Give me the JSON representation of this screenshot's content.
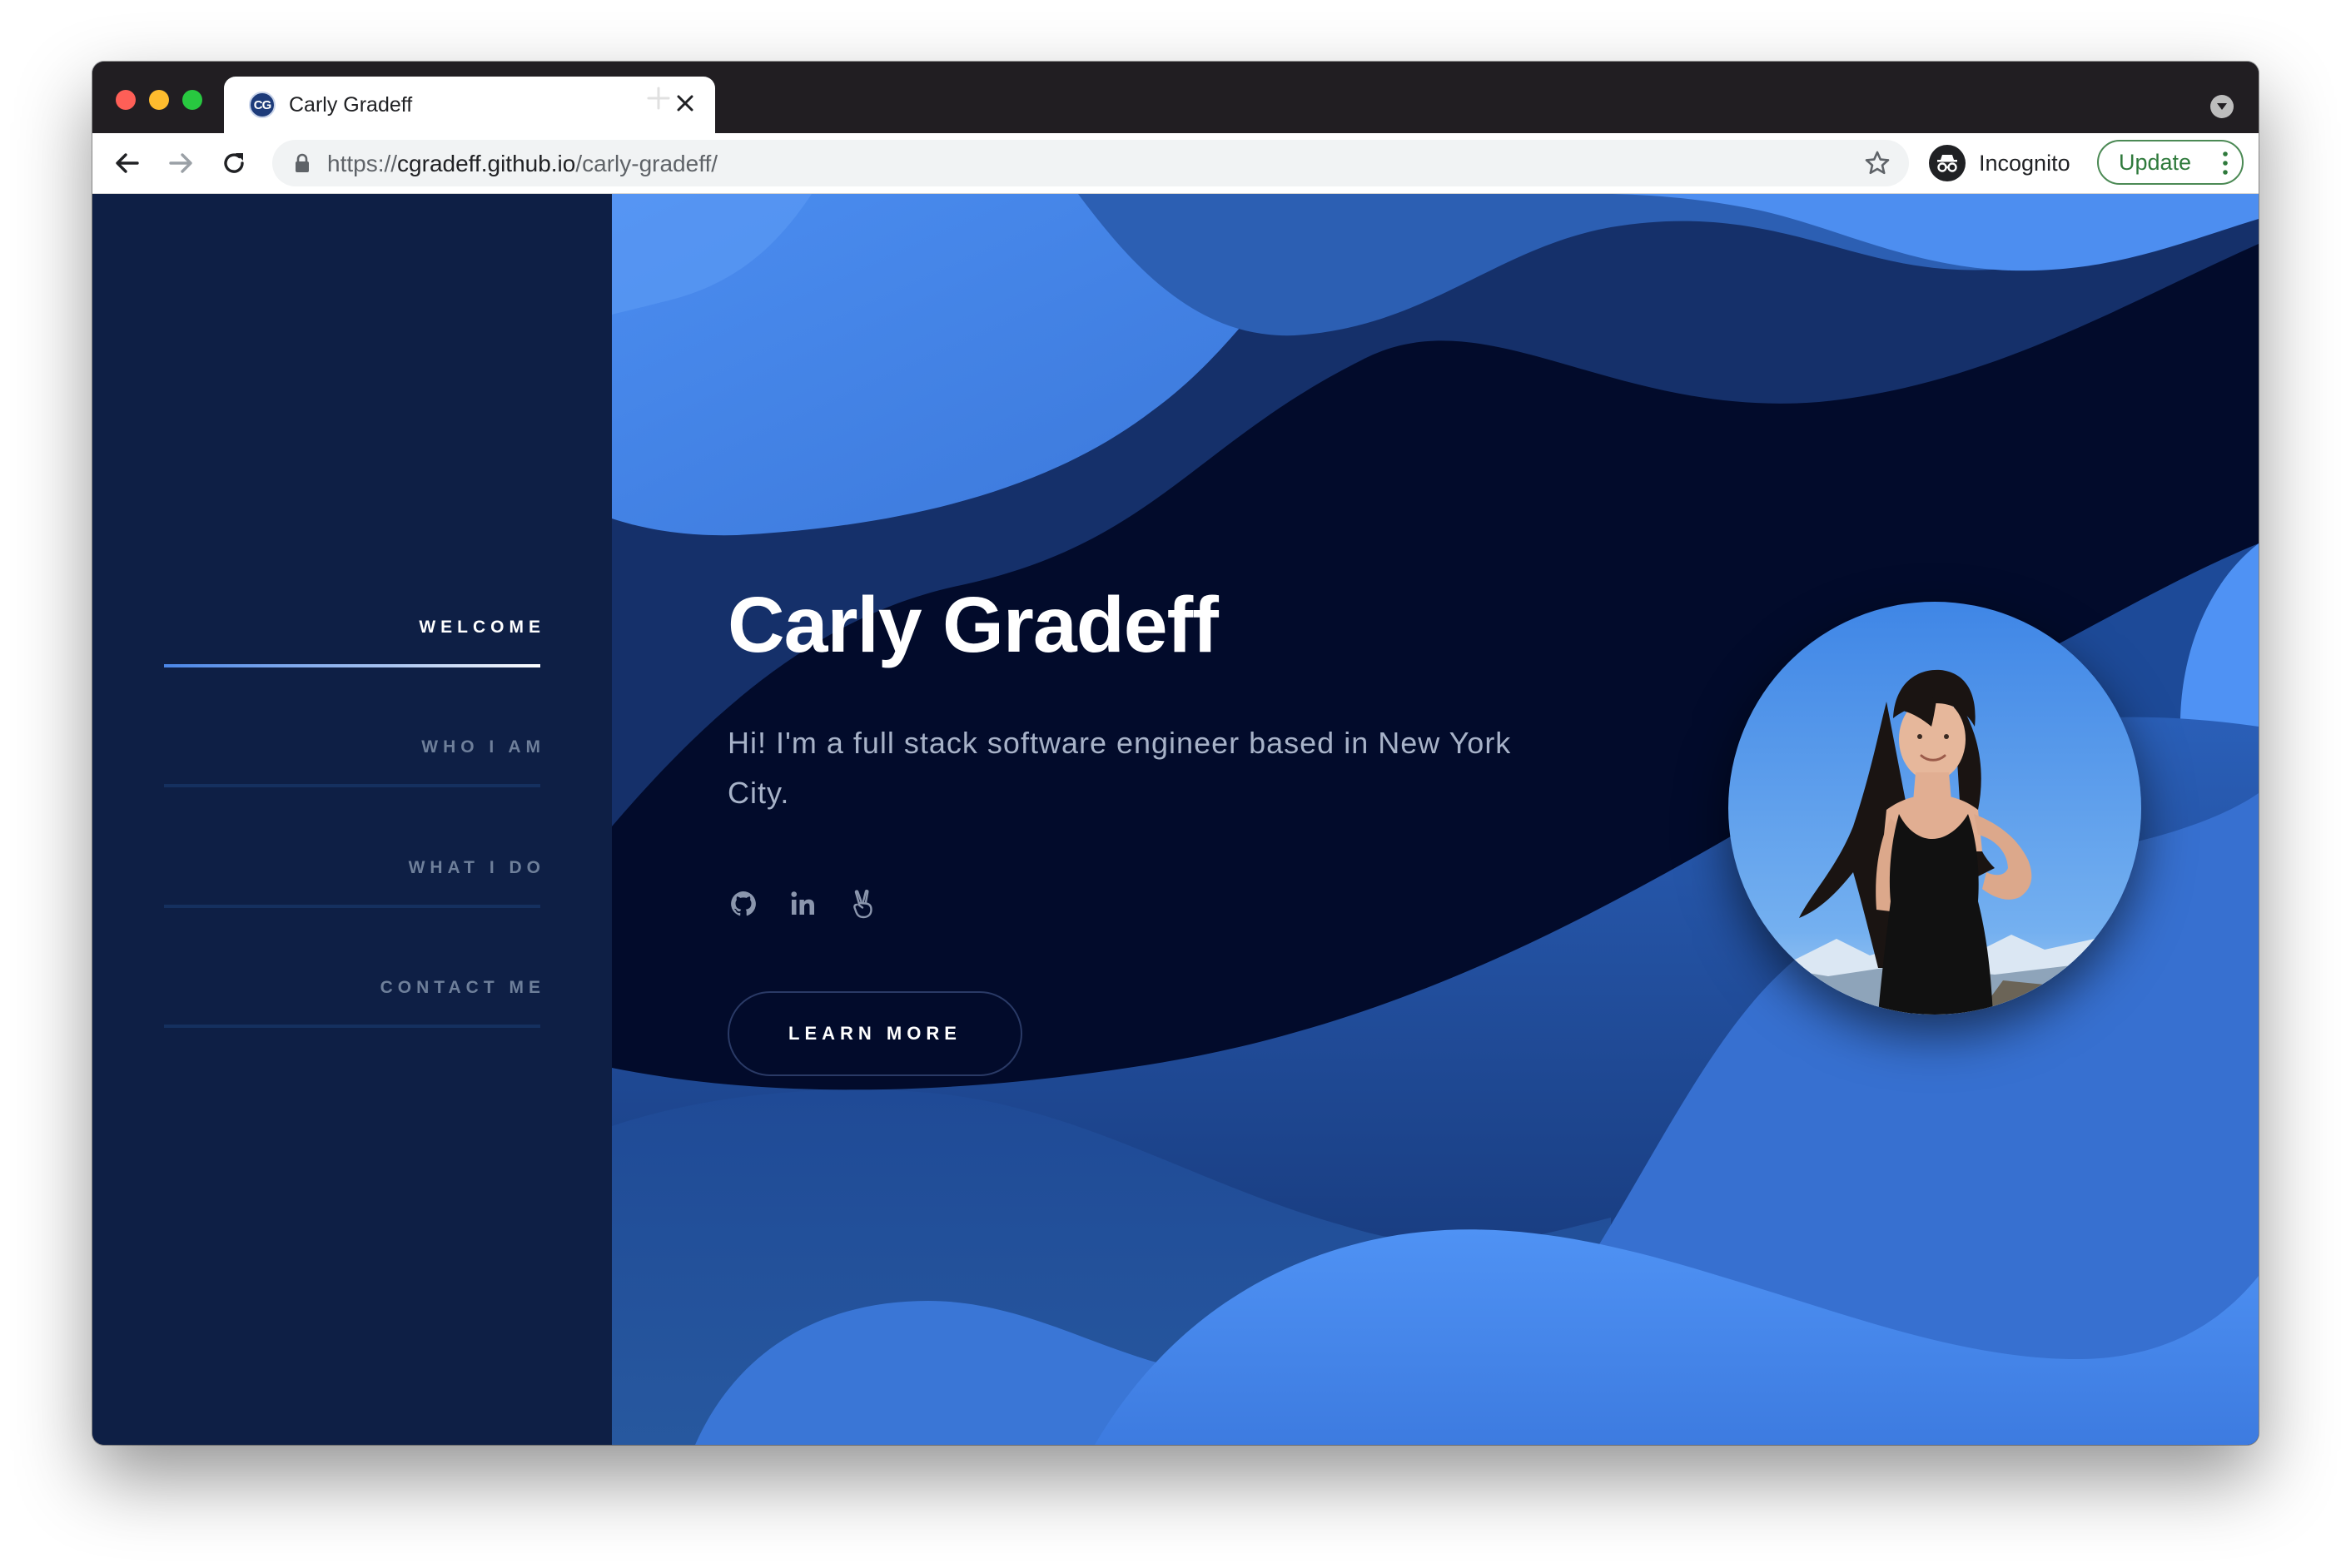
{
  "browser": {
    "tab": {
      "favicon_text": "CG",
      "title": "Carly Gradeff",
      "close_icon": "close-icon"
    },
    "new_tab_icon": "plus-icon",
    "url": {
      "scheme": "https://",
      "host": "cgradeff.github.io",
      "path": "/carly-gradeff/"
    },
    "incognito_label": "Incognito",
    "update_label": "Update"
  },
  "sidebar": {
    "items": [
      {
        "label": "WELCOME",
        "active": true
      },
      {
        "label": "WHO I AM",
        "active": false
      },
      {
        "label": "WHAT I DO",
        "active": false
      },
      {
        "label": "CONTACT ME",
        "active": false
      }
    ]
  },
  "hero": {
    "title": "Carly Gradeff",
    "subtitle": "Hi! I'm a full stack software engineer based in New York City.",
    "socials": [
      "github-icon",
      "linkedin-icon",
      "angellist-icon"
    ],
    "cta_label": "LEARN MORE"
  },
  "colors": {
    "sidebar_bg": "#0e1f45",
    "hero_bg": "#020b2b",
    "accent_blue": "#4a8ef0",
    "update_green": "#2f7a3c"
  }
}
